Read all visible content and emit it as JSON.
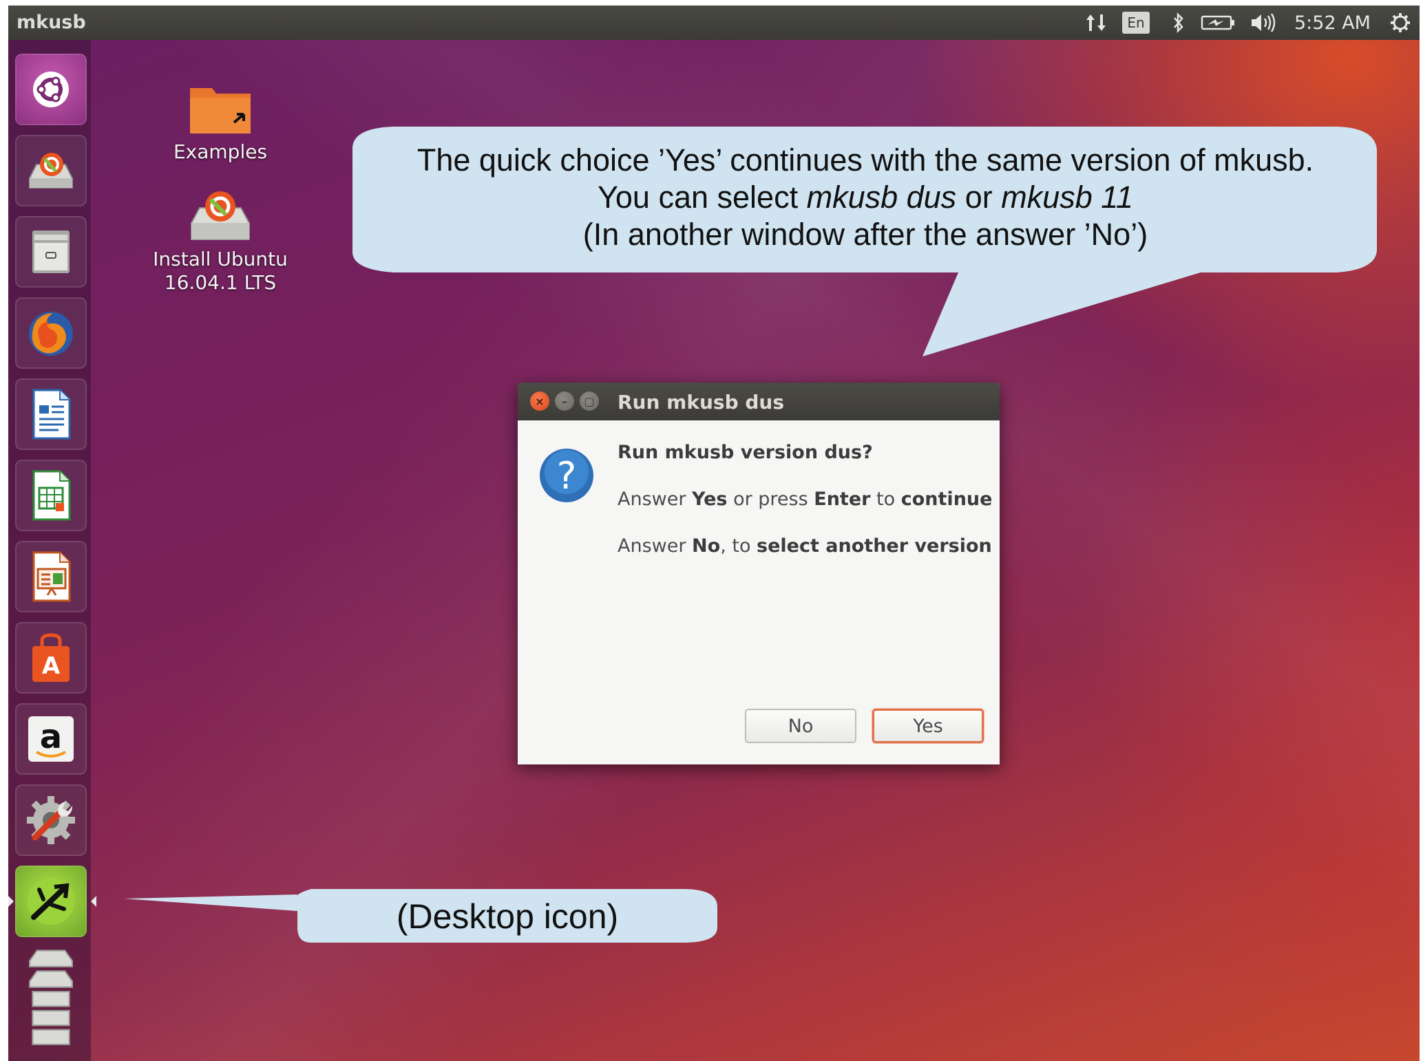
{
  "top_panel": {
    "app_title": "mkusb",
    "indicators": {
      "network_icon": "up-down-arrows-icon",
      "keyboard_layout": "En",
      "bluetooth_icon": "bluetooth-icon",
      "battery_icon": "battery-icon",
      "volume_icon": "speaker-icon",
      "clock": "5:52 AM",
      "session_icon": "gear-power-icon"
    }
  },
  "launcher": {
    "items": [
      {
        "name": "dash-icon"
      },
      {
        "name": "install-ubuntu-icon"
      },
      {
        "name": "file-manager-icon"
      },
      {
        "name": "firefox-icon"
      },
      {
        "name": "libreoffice-writer-icon"
      },
      {
        "name": "libreoffice-calc-icon"
      },
      {
        "name": "libreoffice-impress-icon"
      },
      {
        "name": "software-center-icon"
      },
      {
        "name": "amazon-icon",
        "glyph": "a"
      },
      {
        "name": "system-settings-icon"
      },
      {
        "name": "mkusb-icon"
      },
      {
        "name": "trash-stack-icon"
      }
    ]
  },
  "desktop": {
    "icons": [
      {
        "label": "Examples"
      },
      {
        "label_line1": "Install Ubuntu",
        "label_line2": "16.04.1 LTS"
      }
    ]
  },
  "callouts": {
    "top": {
      "line1": "The quick choice ’Yes’ continues with the same version of mkusb.",
      "line2_pre": "You can select ",
      "line2_em1": "mkusb dus",
      "line2_mid": " or ",
      "line2_em2": "mkusb 11",
      "line3": "(In another window after the answer ’No’)"
    },
    "bottom": {
      "text": "(Desktop icon)"
    }
  },
  "dialog": {
    "title": "Run mkusb dus",
    "heading": "Run mkusb version dus?",
    "line1": {
      "a": "Answer ",
      "b": "Yes",
      "c": " or press ",
      "d": "Enter",
      "e": " to ",
      "f": "continue"
    },
    "line2": {
      "a": "Answer ",
      "b": "No",
      "c": ", to ",
      "d": "select another version"
    },
    "buttons": {
      "no": "No",
      "yes": "Yes"
    }
  },
  "colors": {
    "ubuntu_orange": "#E95420",
    "panel": "#3c3b37",
    "callout_fill": "#cfe3f0"
  }
}
